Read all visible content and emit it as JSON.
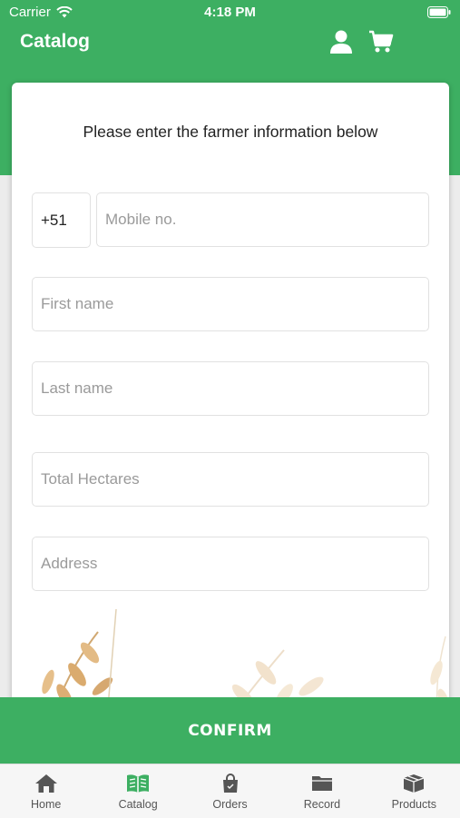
{
  "status_bar": {
    "carrier": "Carrier",
    "time": "4:18 PM"
  },
  "header": {
    "title": "Catalog",
    "icons": [
      "user-icon",
      "cart-icon"
    ]
  },
  "form": {
    "instruction": "Please enter the farmer information below",
    "country_code": "+51",
    "mobile_placeholder": "Mobile no.",
    "first_name_placeholder": "First name",
    "last_name_placeholder": "Last name",
    "hectares_placeholder": "Total Hectares",
    "address_placeholder": "Address"
  },
  "confirm_label": "CONFIRM",
  "tabs": [
    {
      "label": "Home",
      "icon": "home-icon"
    },
    {
      "label": "Catalog",
      "icon": "catalog-icon",
      "active": true
    },
    {
      "label": "Orders",
      "icon": "orders-icon"
    },
    {
      "label": "Record",
      "icon": "folder-icon"
    },
    {
      "label": "Products",
      "icon": "products-icon"
    }
  ],
  "colors": {
    "brand_green": "#3daf62",
    "active_tab": "#3daf62",
    "inactive_tab": "#555555"
  }
}
